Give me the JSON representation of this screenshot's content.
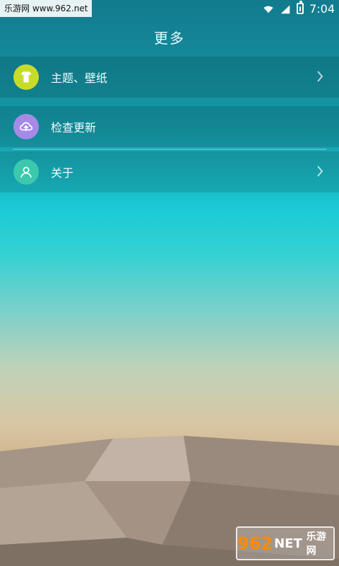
{
  "status_bar": {
    "watermark": "乐游网 www.962.net",
    "time": "7:04",
    "battery_level": 0.6
  },
  "header": {
    "title": "更多"
  },
  "menu": {
    "items": [
      {
        "label": "主题、壁纸",
        "icon": "tshirt-icon",
        "icon_color": "#c7dc2a",
        "has_chevron": true
      },
      {
        "label": "检查更新",
        "icon": "cloud-upload-icon",
        "icon_color": "#a68ae8",
        "has_chevron": false
      },
      {
        "label": "关于",
        "icon": "user-icon",
        "icon_color": "#3bc8ad",
        "has_chevron": true
      }
    ]
  },
  "watermark_bottom": {
    "brand_numeric": "962",
    "brand_suffix": "NET",
    "brand_cn": "乐游网"
  },
  "colors": {
    "primary_teal": "#127b8e",
    "accent_turquoise": "#1ccbd6",
    "sand": "#b7a89a"
  }
}
